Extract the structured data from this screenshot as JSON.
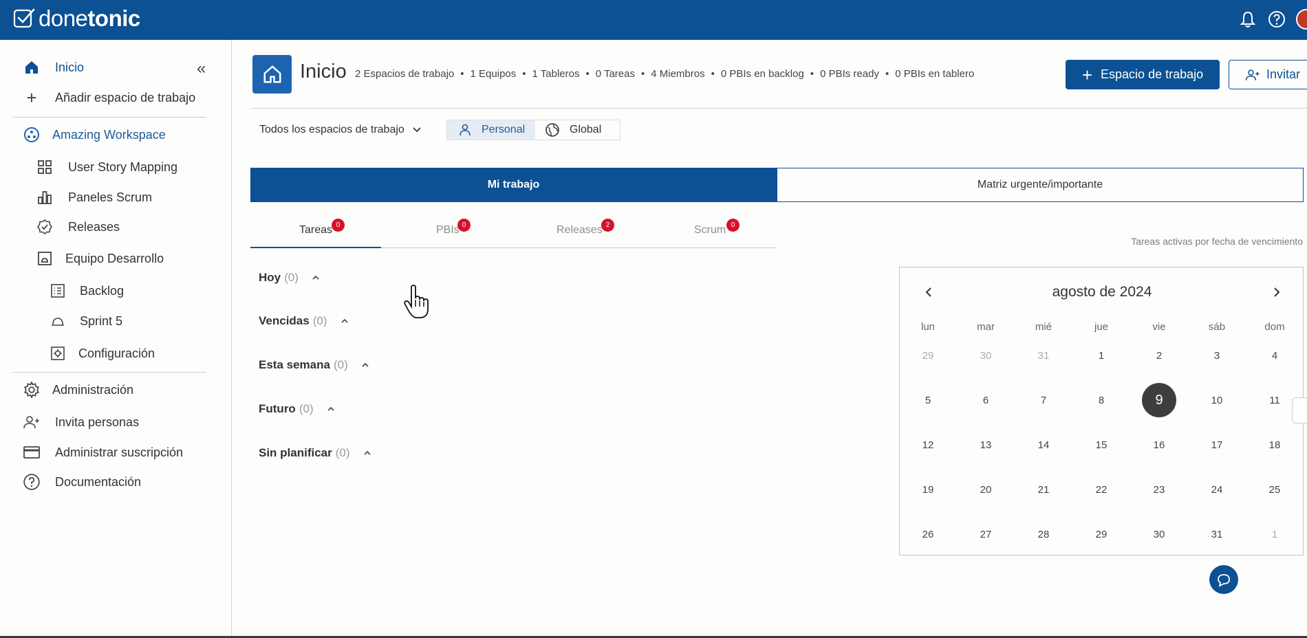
{
  "brand": {
    "logo_light": "done",
    "logo_bold": "tonic",
    "primary_color": "#0c5193"
  },
  "topbar": {
    "icons": [
      "bell-icon",
      "help-icon",
      "avatar"
    ]
  },
  "sidebar": {
    "items": [
      {
        "label": "Inicio",
        "icon": "home-icon"
      },
      {
        "label": "Añadir espacio de trabajo",
        "icon": "plus-icon"
      },
      {
        "label": "Amazing Workspace",
        "icon": "workspace-icon"
      },
      {
        "label": "User Story Mapping",
        "icon": "grid-icon"
      },
      {
        "label": "Paneles Scrum",
        "icon": "chart-icon"
      },
      {
        "label": "Releases",
        "icon": "badge-check-icon"
      },
      {
        "label": "Equipo Desarrollo",
        "icon": "team-icon"
      },
      {
        "label": "Backlog",
        "icon": "list-icon"
      },
      {
        "label": "Sprint 5",
        "icon": "sprint-icon"
      },
      {
        "label": "Configuración",
        "icon": "settings-box-icon"
      },
      {
        "label": "Administración",
        "icon": "gear-icon"
      },
      {
        "label": "Invita personas",
        "icon": "user-add-icon"
      },
      {
        "label": "Administrar suscripción",
        "icon": "card-icon"
      },
      {
        "label": "Documentación",
        "icon": "question-icon"
      }
    ]
  },
  "header": {
    "title": "Inicio",
    "stats": [
      "2 Espacios de trabajo",
      "1 Equipos",
      "1 Tableros",
      "0 Tareas",
      "4 Miembros",
      "0 PBIs en backlog",
      "0 PBIs ready",
      "0 PBIs en tablero"
    ],
    "primary_button": "Espacio de trabajo",
    "invite_button": "Invitar"
  },
  "filters": {
    "workspace_select": "Todos los espacios de trabajo",
    "scope_personal": "Personal",
    "scope_global": "Global"
  },
  "tabs": {
    "mine": "Mi trabajo",
    "matrix": "Matriz urgente/importante"
  },
  "subtabs": [
    {
      "label": "Tareas",
      "badge": "0"
    },
    {
      "label": "PBIs",
      "badge": "0"
    },
    {
      "label": "Releases",
      "badge": "2"
    },
    {
      "label": "Scrum",
      "badge": "0"
    }
  ],
  "hint": "Tareas activas por fecha de vencimiento",
  "groups": [
    {
      "label": "Hoy",
      "count": "(0)"
    },
    {
      "label": "Vencidas",
      "count": "(0)"
    },
    {
      "label": "Esta semana",
      "count": "(0)"
    },
    {
      "label": "Futuro",
      "count": "(0)"
    },
    {
      "label": "Sin planificar",
      "count": "(0)"
    }
  ],
  "calendar": {
    "title": "agosto de 2024",
    "weekdays": [
      "lun",
      "mar",
      "mié",
      "jue",
      "vie",
      "sáb",
      "dom"
    ],
    "weeks": [
      [
        "29",
        "30",
        "31",
        "1",
        "2",
        "3",
        "4"
      ],
      [
        "5",
        "6",
        "7",
        "8",
        "9",
        "10",
        "11"
      ],
      [
        "12",
        "13",
        "14",
        "15",
        "16",
        "17",
        "18"
      ],
      [
        "19",
        "20",
        "21",
        "22",
        "23",
        "24",
        "25"
      ],
      [
        "26",
        "27",
        "28",
        "29",
        "30",
        "31",
        "1"
      ]
    ],
    "selected": "9"
  }
}
